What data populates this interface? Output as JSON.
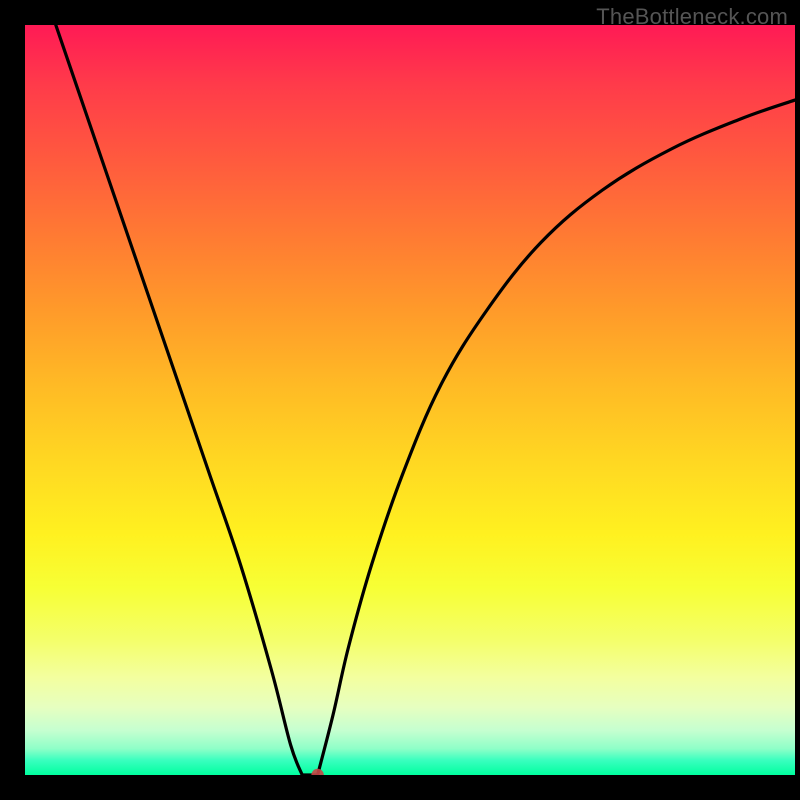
{
  "watermark": "TheBottleneck.com",
  "colors": {
    "curve": "#000000",
    "marker": "rgba(200,70,70,0.9)",
    "gradient_top": "#ff1a55",
    "gradient_bottom": "#00ff9f"
  },
  "chart_data": {
    "type": "line",
    "title": "",
    "xlabel": "",
    "ylabel": "",
    "xlim": [
      0,
      100
    ],
    "ylim": [
      0,
      100
    ],
    "grid": false,
    "legend": false,
    "annotations": [],
    "series": [
      {
        "name": "left-branch",
        "x": [
          4,
          8,
          12,
          16,
          20,
          24,
          28,
          32,
          34.5,
          36
        ],
        "y": [
          100,
          88,
          76,
          64,
          52,
          40,
          28,
          14,
          4,
          0
        ]
      },
      {
        "name": "right-branch",
        "x": [
          38,
          40,
          42,
          45,
          49,
          54,
          60,
          67,
          75,
          84,
          93,
          100
        ],
        "y": [
          0,
          8,
          17,
          28,
          40,
          52,
          62,
          71,
          78,
          83.5,
          87.5,
          90
        ]
      },
      {
        "name": "floor",
        "x": [
          36,
          38
        ],
        "y": [
          0,
          0
        ]
      }
    ],
    "marker": {
      "x": 38,
      "y": 0,
      "label": ""
    },
    "background": "red-yellow-green vertical gradient (bottleneck severity scale)"
  }
}
